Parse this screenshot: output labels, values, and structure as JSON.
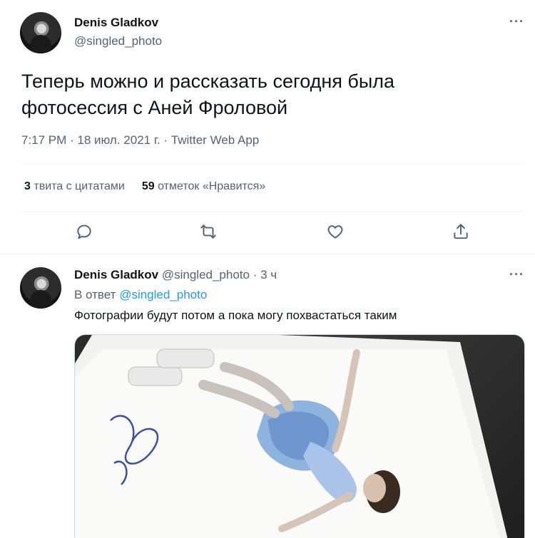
{
  "main_tweet": {
    "author_name": "Denis Gladkov",
    "author_handle": "@singled_photo",
    "text_line1": "Теперь можно и рассказать сегодня была",
    "text_line2": "фотосессия с Аней Фроловой",
    "meta": "7:17 PM · 18 июл. 2021 г. · Twitter Web App",
    "quote_count": "3",
    "quote_label": "твита с цитатами",
    "like_count": "59",
    "like_label": "отметок «Нравится»",
    "more": "···",
    "actions": [
      "reply-icon",
      "retweet-icon",
      "like-icon",
      "share-icon"
    ]
  },
  "reply_tweet": {
    "author_name": "Denis Gladkov",
    "author_handle": "@singled_photo",
    "time": "· 3 ч",
    "reply_prefix": "В ответ",
    "reply_to": "@singled_photo",
    "text": "Фотографии будут потом а пока могу похвастаться таким",
    "more": "···"
  },
  "colors": {
    "primary_text": "#0f1419",
    "secondary_text": "#536471",
    "link": "#1d9bf0",
    "divider": "#eff3f4"
  }
}
